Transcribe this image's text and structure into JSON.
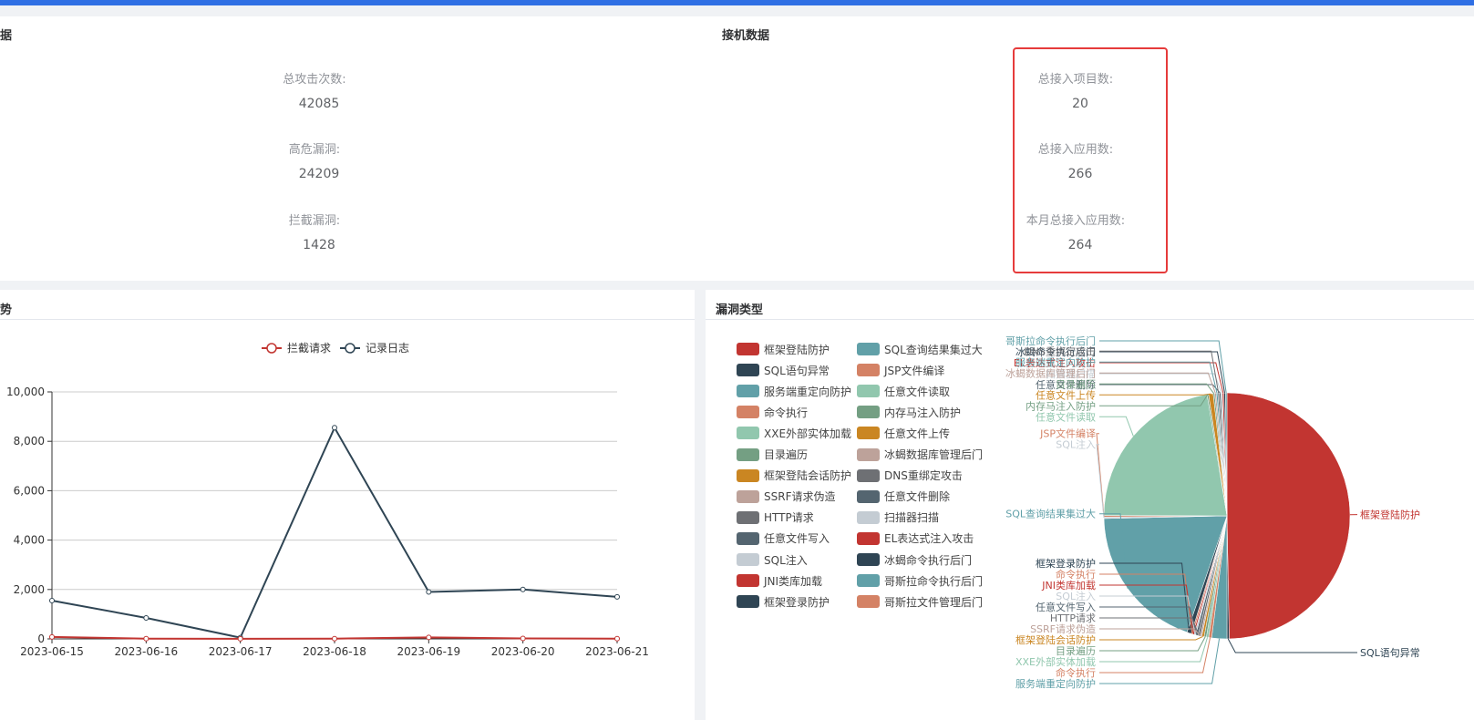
{
  "stats_left": {
    "title_fragment": "据",
    "items": [
      {
        "label": "总攻击次数:",
        "value": "42085"
      },
      {
        "label": "高危漏洞:",
        "value": "24209"
      },
      {
        "label": "拦截漏洞:",
        "value": "1428"
      }
    ]
  },
  "stats_right": {
    "title": "接机数据",
    "items": [
      {
        "label": "总接入项目数:",
        "value": "20"
      },
      {
        "label": "总接入应用数:",
        "value": "266"
      },
      {
        "label": "本月总接入应用数:",
        "value": "264"
      }
    ]
  },
  "trend_panel": {
    "title_fragment": "势"
  },
  "vuln_panel": {
    "title": "漏洞类型"
  },
  "colors": {
    "accent": "#2f6fe4",
    "highlight": "#e63b3b"
  },
  "chart_data": [
    {
      "type": "line",
      "x": [
        "2023-06-15",
        "2023-06-16",
        "2023-06-17",
        "2023-06-18",
        "2023-06-19",
        "2023-06-20",
        "2023-06-21"
      ],
      "ylim": [
        0,
        10000
      ],
      "yticks": [
        "0",
        "2,000",
        "4,000",
        "6,000",
        "8,000",
        "10,000"
      ],
      "grid": true,
      "legend_position": "top",
      "series": [
        {
          "name": "拦截请求",
          "color": "#c23531",
          "values": [
            80,
            10,
            5,
            10,
            60,
            20,
            10
          ]
        },
        {
          "name": "记录日志",
          "color": "#2f4554",
          "values": [
            1550,
            850,
            50,
            8550,
            1900,
            2000,
            1700
          ]
        }
      ]
    },
    {
      "type": "pie",
      "legend_position": "left",
      "legend": [
        {
          "name": "框架登陆防护",
          "color": "#c23531"
        },
        {
          "name": "SQL查询结果集过大",
          "color": "#61a0a8"
        },
        {
          "name": "SQL语句异常",
          "color": "#2f4554"
        },
        {
          "name": "JSP文件编译",
          "color": "#d48265"
        },
        {
          "name": "服务端重定向防护",
          "color": "#61a0a8"
        },
        {
          "name": "任意文件读取",
          "color": "#91c7ae"
        },
        {
          "name": "命令执行",
          "color": "#d48265"
        },
        {
          "name": "内存马注入防护",
          "color": "#749f83"
        },
        {
          "name": "XXE外部实体加载",
          "color": "#91c7ae"
        },
        {
          "name": "任意文件上传",
          "color": "#ca8622"
        },
        {
          "name": "目录遍历",
          "color": "#749f83"
        },
        {
          "name": "冰蝎数据库管理后门",
          "color": "#bda29a"
        },
        {
          "name": "框架登陆会话防护",
          "color": "#ca8622"
        },
        {
          "name": "DNS重绑定攻击",
          "color": "#6e7074"
        },
        {
          "name": "SSRF请求伪造",
          "color": "#bda29a"
        },
        {
          "name": "任意文件删除",
          "color": "#546570"
        },
        {
          "name": "HTTP请求",
          "color": "#6e7074"
        },
        {
          "name": "扫描器扫描",
          "color": "#c4ccd3"
        },
        {
          "name": "任意文件写入",
          "color": "#546570"
        },
        {
          "name": "EL表达式注入攻击",
          "color": "#c23531"
        },
        {
          "name": "SQL注入",
          "color": "#c4ccd3"
        },
        {
          "name": "冰蝎命令执行后门",
          "color": "#2f4554"
        },
        {
          "name": "JNI类库加载",
          "color": "#c23531"
        },
        {
          "name": "哥斯拉命令执行后门",
          "color": "#61a0a8"
        },
        {
          "name": "框架登录防护",
          "color": "#2f4554"
        },
        {
          "name": "哥斯拉文件管理后门",
          "color": "#d48265"
        }
      ],
      "slices": [
        {
          "name": "框架登陆防护",
          "value": 50.0,
          "color": "#c23531"
        },
        {
          "name": "SQL语句异常",
          "value": 0.3,
          "color": "#2f4554"
        },
        {
          "name": "服务端重定向防护",
          "value": 2.0,
          "color": "#61a0a8"
        },
        {
          "name": "命令执行",
          "value": 0.4,
          "color": "#d48265"
        },
        {
          "name": "XXE外部实体加载",
          "value": 0.3,
          "color": "#91c7ae"
        },
        {
          "name": "目录遍历",
          "value": 0.3,
          "color": "#749f83"
        },
        {
          "name": "框架登陆会话防护",
          "value": 0.3,
          "color": "#ca8622"
        },
        {
          "name": "SSRF请求伪造",
          "value": 0.2,
          "color": "#bda29a"
        },
        {
          "name": "HTTP请求",
          "value": 0.3,
          "color": "#6e7074"
        },
        {
          "name": "任意文件写入",
          "value": 0.3,
          "color": "#546570"
        },
        {
          "name": "SQL注入",
          "value": 0.2,
          "color": "#c4ccd3"
        },
        {
          "name": "JNI类库加载",
          "value": 0.2,
          "color": "#c23531"
        },
        {
          "name": "命令执行",
          "value": 0.2,
          "color": "#d48265"
        },
        {
          "name": "框架登录防护",
          "value": 0.6,
          "color": "#2f4554"
        },
        {
          "name": "SQL查询结果集过大",
          "value": 19.5,
          "color": "#61a0a8"
        },
        {
          "name": "SQL注入",
          "value": 0.2,
          "color": "#c4ccd3"
        },
        {
          "name": "JSP文件编译",
          "value": 0.2,
          "color": "#d48265"
        },
        {
          "name": "任意文件读取",
          "value": 22.5,
          "color": "#91c7ae"
        },
        {
          "name": "内存马注入防护",
          "value": 0.2,
          "color": "#749f83"
        },
        {
          "name": "任意文件上传",
          "value": 0.6,
          "color": "#ca8622"
        },
        {
          "name": "目录遍历",
          "value": 0.2,
          "color": "#749f83"
        },
        {
          "name": "冰蝎数据库管理后门",
          "value": 0.2,
          "color": "#bda29a"
        },
        {
          "name": "服务端重定向防护",
          "value": 0.2,
          "color": "#61a0a8"
        },
        {
          "name": "DNS重绑定攻击",
          "value": 0.2,
          "color": "#6e7074"
        },
        {
          "name": "任意文件删除",
          "value": 0.2,
          "color": "#546570"
        },
        {
          "name": "扫描器扫描",
          "value": 0.2,
          "color": "#c4ccd3"
        },
        {
          "name": "EL表达式注入攻击",
          "value": 0.2,
          "color": "#c23531"
        },
        {
          "name": "冰蝎命令执行后门",
          "value": 0.2,
          "color": "#2f4554"
        },
        {
          "name": "哥斯拉命令执行后门",
          "value": 0.2,
          "color": "#61a0a8"
        }
      ]
    }
  ]
}
